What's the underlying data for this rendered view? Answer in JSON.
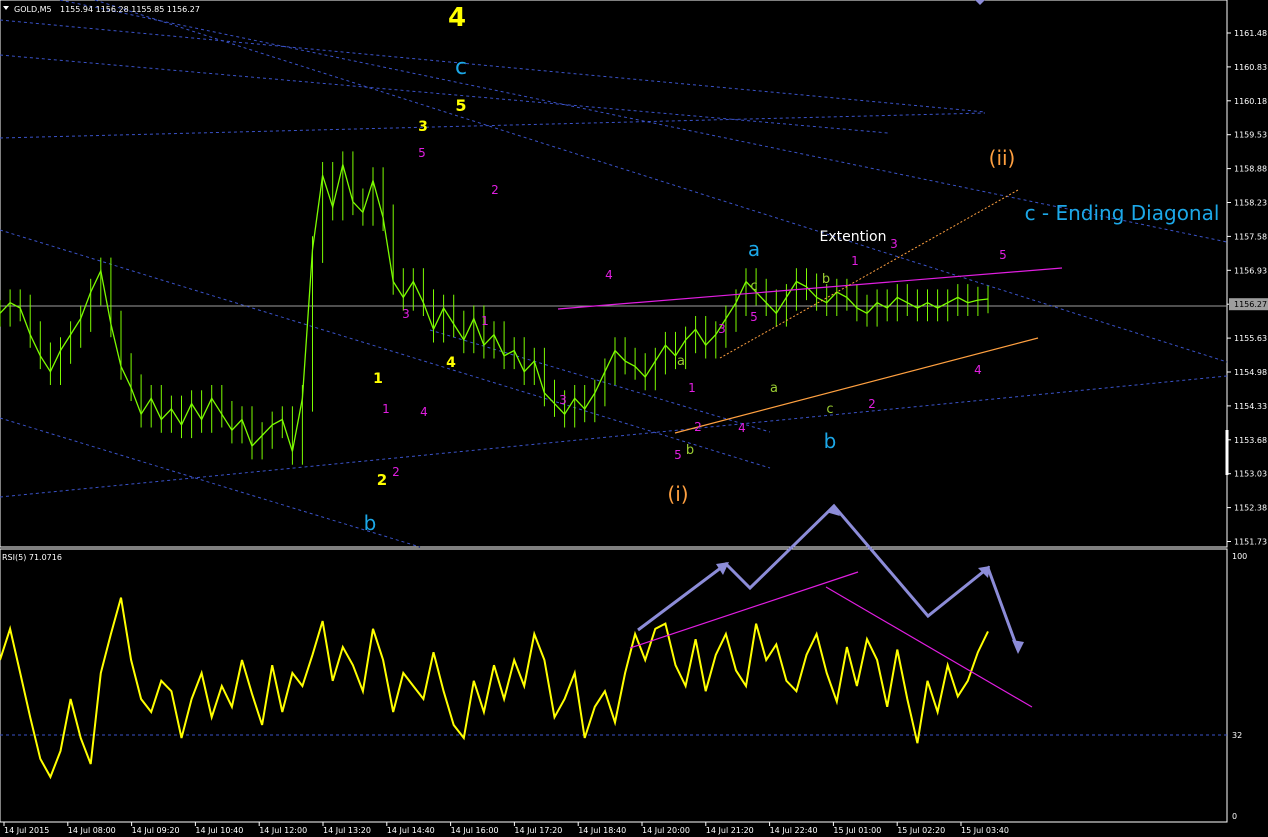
{
  "header": {
    "symbol": "GOLD,M5",
    "ohlc": "1155.94 1156.28 1155.85 1156.27",
    "rsi_label": "RSI(5) 71.0716"
  },
  "colors": {
    "background": "#000000",
    "price": "#7CFC00",
    "rsi": "#FFFF00",
    "grid_dash": "#3a52c8",
    "magenta": "#e01ee0",
    "orange": "#FFA040",
    "cyan": "#1CA8E8",
    "yellow": "#FFFF00",
    "olive": "#9ACD32",
    "purple_arrow": "#8C8CD8"
  },
  "chart_data": [
    {
      "type": "line",
      "title": "GOLD,M5",
      "price_axis_ticks": [
        "1161.48",
        "1160.83",
        "1160.18",
        "1159.53",
        "1158.88",
        "1158.23",
        "1157.58",
        "1156.93",
        "1156.27",
        "1155.63",
        "1154.98",
        "1154.33",
        "1153.68",
        "1153.03",
        "1152.38",
        "1151.73"
      ],
      "current_price": "1156.27",
      "ylim": [
        1151.6,
        1161.9
      ],
      "time_labels": [
        "14 Jul 2015",
        "14 Jul 08:00",
        "14 Jul 09:20",
        "14 Jul 10:40",
        "14 Jul 12:00",
        "14 Jul 13:20",
        "14 Jul 14:40",
        "14 Jul 16:00",
        "14 Jul 17:20",
        "14 Jul 18:40",
        "14 Jul 20:00",
        "14 Jul 21:20",
        "14 Jul 22:40",
        "15 Jul 01:00",
        "15 Jul 02:20",
        "15 Jul 03:40"
      ],
      "x": [
        0,
        2,
        4,
        6,
        8,
        10,
        12,
        14,
        16,
        18,
        20,
        22,
        24,
        26,
        28,
        30,
        32,
        34,
        36,
        38,
        40,
        42,
        44,
        46,
        48,
        50,
        52,
        54,
        56,
        58,
        60,
        62,
        64,
        66,
        68,
        70,
        72,
        74,
        76,
        78,
        80,
        82,
        84,
        86,
        88,
        90,
        92,
        94,
        96,
        98,
        100,
        102,
        104,
        106,
        108,
        110,
        112,
        114,
        116,
        118,
        120,
        122,
        124,
        126,
        128,
        130,
        132,
        134,
        136,
        138,
        140,
        142,
        144,
        146,
        148,
        150,
        152,
        154,
        156,
        158,
        160,
        162,
        164,
        166,
        168,
        170,
        172,
        174,
        176,
        178,
        180,
        182,
        184,
        186,
        188,
        190,
        192,
        194,
        196
      ],
      "close": [
        1156.0,
        1156.2,
        1156.1,
        1155.6,
        1155.2,
        1154.9,
        1155.3,
        1155.6,
        1155.9,
        1156.4,
        1156.8,
        1155.8,
        1155.0,
        1154.6,
        1154.1,
        1154.4,
        1154.0,
        1154.2,
        1153.9,
        1154.3,
        1154.0,
        1154.4,
        1154.1,
        1153.8,
        1154.0,
        1153.5,
        1153.7,
        1153.9,
        1154.0,
        1153.4,
        1154.4,
        1157.2,
        1158.6,
        1158.0,
        1158.8,
        1158.1,
        1157.9,
        1158.5,
        1157.8,
        1156.6,
        1156.3,
        1156.6,
        1156.2,
        1155.7,
        1156.1,
        1155.8,
        1155.5,
        1155.9,
        1155.4,
        1155.6,
        1155.2,
        1155.3,
        1154.9,
        1155.1,
        1154.5,
        1154.3,
        1154.1,
        1154.4,
        1154.2,
        1154.5,
        1154.9,
        1155.3,
        1155.1,
        1155.0,
        1154.8,
        1155.1,
        1155.4,
        1155.2,
        1155.5,
        1155.7,
        1155.4,
        1155.6,
        1155.9,
        1156.2,
        1156.6,
        1156.4,
        1156.2,
        1156.0,
        1156.3,
        1156.6,
        1156.5,
        1156.3,
        1156.2,
        1156.4,
        1156.3,
        1156.1,
        1156.0,
        1156.2,
        1156.1,
        1156.3,
        1156.2,
        1156.1,
        1156.2,
        1156.1,
        1156.2,
        1156.3,
        1156.2,
        1156.25,
        1156.27
      ]
    },
    {
      "type": "line",
      "title": "RSI(5) 71.0716",
      "rsi_axis_ticks": [
        "100",
        "32",
        "0"
      ],
      "ylim": [
        0,
        100
      ],
      "x": [
        0,
        2,
        4,
        6,
        8,
        10,
        12,
        14,
        16,
        18,
        20,
        22,
        24,
        26,
        28,
        30,
        32,
        34,
        36,
        38,
        40,
        42,
        44,
        46,
        48,
        50,
        52,
        54,
        56,
        58,
        60,
        62,
        64,
        66,
        68,
        70,
        72,
        74,
        76,
        78,
        80,
        82,
        84,
        86,
        88,
        90,
        92,
        94,
        96,
        98,
        100,
        102,
        104,
        106,
        108,
        110,
        112,
        114,
        116,
        118,
        120,
        122,
        124,
        126,
        128,
        130,
        132,
        134,
        136,
        138,
        140,
        142,
        144,
        146,
        148,
        150,
        152,
        154,
        156,
        158,
        160,
        162,
        164,
        166,
        168,
        170,
        172,
        174,
        176,
        178,
        180,
        182,
        184,
        186,
        188,
        190,
        192,
        194,
        196
      ],
      "values": [
        60,
        72,
        55,
        38,
        22,
        15,
        25,
        45,
        30,
        20,
        55,
        70,
        84,
        60,
        45,
        40,
        52,
        48,
        30,
        45,
        55,
        38,
        50,
        42,
        60,
        47,
        35,
        58,
        40,
        55,
        50,
        62,
        75,
        52,
        65,
        58,
        48,
        72,
        60,
        40,
        55,
        50,
        45,
        63,
        48,
        35,
        30,
        52,
        40,
        58,
        45,
        60,
        50,
        70,
        60,
        38,
        45,
        55,
        30,
        42,
        48,
        36,
        55,
        70,
        60,
        72,
        74,
        58,
        50,
        68,
        48,
        62,
        70,
        56,
        50,
        74,
        60,
        66,
        52,
        48,
        62,
        70,
        55,
        44,
        65,
        50,
        68,
        60,
        42,
        64,
        45,
        28,
        52,
        40,
        58,
        46,
        52,
        63,
        71
      ]
    }
  ],
  "annotations": [
    {
      "text": "4",
      "color": "yellow",
      "size": 26
    },
    {
      "text": "c",
      "color": "cyan",
      "size": 22
    },
    {
      "text": "5",
      "color": "yellow",
      "size": 16
    },
    {
      "text": "3",
      "color": "yellow",
      "size": 14
    },
    {
      "text": "5",
      "color": "magenta",
      "size": 12
    },
    {
      "text": "2",
      "color": "magenta",
      "size": 12
    },
    {
      "text": "3",
      "color": "magenta",
      "size": 12
    },
    {
      "text": "1",
      "color": "magenta",
      "size": 12
    },
    {
      "text": "4",
      "color": "yellow",
      "size": 14
    },
    {
      "text": "1",
      "color": "yellow",
      "size": 14
    },
    {
      "text": "1",
      "color": "magenta",
      "size": 12
    },
    {
      "text": "4",
      "color": "magenta",
      "size": 12
    },
    {
      "text": "2",
      "color": "yellow",
      "size": 15
    },
    {
      "text": "2",
      "color": "magenta",
      "size": 12
    },
    {
      "text": "b",
      "color": "cyan",
      "size": 20
    },
    {
      "text": "4",
      "color": "magenta",
      "size": 12
    },
    {
      "text": "3",
      "color": "magenta",
      "size": 12
    },
    {
      "text": "5",
      "color": "magenta",
      "size": 12
    },
    {
      "text": "b",
      "color": "olive",
      "size": 13
    },
    {
      "text": "(i)",
      "color": "orange",
      "size": 20
    },
    {
      "text": "a",
      "color": "olive",
      "size": 13
    },
    {
      "text": "1",
      "color": "magenta",
      "size": 12
    },
    {
      "text": "2",
      "color": "magenta",
      "size": 12
    },
    {
      "text": "4",
      "color": "magenta",
      "size": 12
    },
    {
      "text": "3",
      "color": "magenta",
      "size": 12
    },
    {
      "text": "5",
      "color": "magenta",
      "size": 12
    },
    {
      "text": "a",
      "color": "cyan",
      "size": 20
    },
    {
      "text": "c",
      "color": "olive",
      "size": 13
    },
    {
      "text": "a",
      "color": "olive",
      "size": 13
    },
    {
      "text": "b",
      "color": "olive",
      "size": 13
    },
    {
      "text": "c",
      "color": "olive",
      "size": 13
    },
    {
      "text": "b",
      "color": "cyan",
      "size": 20
    },
    {
      "text": "1",
      "color": "magenta",
      "size": 12
    },
    {
      "text": "3",
      "color": "magenta",
      "size": 12
    },
    {
      "text": "Extention",
      "color": "white",
      "size": 14
    },
    {
      "text": "2",
      "color": "magenta",
      "size": 12
    },
    {
      "text": "5",
      "color": "magenta",
      "size": 12
    },
    {
      "text": "4",
      "color": "magenta",
      "size": 12
    },
    {
      "text": "(ii)",
      "color": "orange",
      "size": 20
    },
    {
      "text": "c - Ending Diagonal",
      "color": "cyan",
      "size": 20
    }
  ]
}
